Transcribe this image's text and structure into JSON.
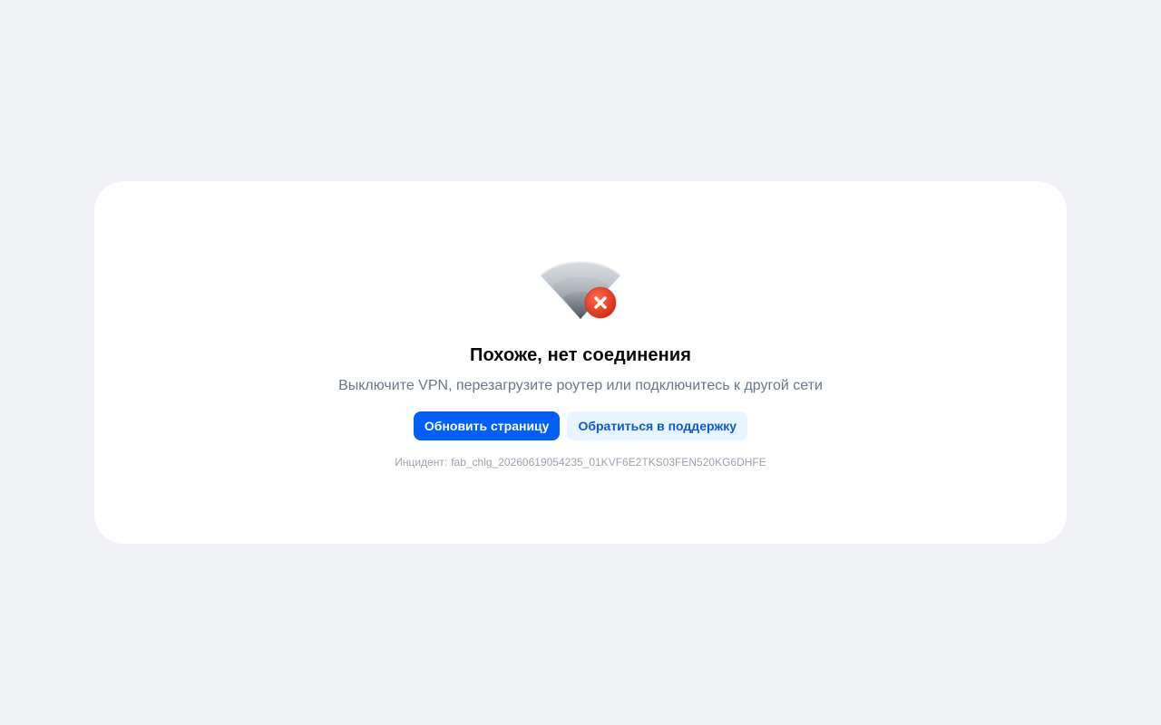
{
  "error": {
    "icon": "no-wifi-icon",
    "title": "Похоже, нет соединения",
    "subtitle": "Выключите VPN, перезагрузите роутер или подключитесь к другой сети",
    "refresh_button": "Обновить страницу",
    "support_button": "Обратиться в поддержку",
    "incident_label": "Инцидент:",
    "incident_id": "fab_chlg_20260619054235_01KVF6E2TKS03FEN520KG6DHFE"
  },
  "colors": {
    "background": "#f0f2f5",
    "card": "#ffffff",
    "primary": "#005ff9",
    "secondary_bg": "#e8f4ff",
    "error_badge": "#e8361c"
  }
}
